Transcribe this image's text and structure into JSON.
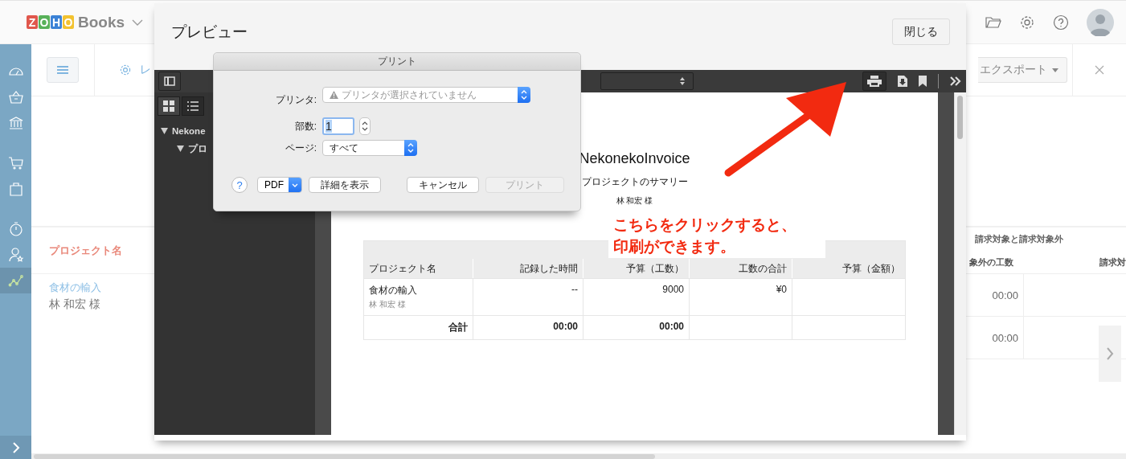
{
  "topbar": {
    "logo_letters": [
      {
        "letter": "Z",
        "color": "#e0574c"
      },
      {
        "letter": "O",
        "color": "#58b15a"
      },
      {
        "letter": "H",
        "color": "#3b82d6"
      },
      {
        "letter": "O",
        "color": "#f2c230"
      }
    ],
    "product": "Books"
  },
  "sidebar": {
    "groups": [
      {
        "items": [
          {
            "kind": "dashboard",
            "selected": false
          },
          {
            "kind": "basket",
            "selected": false
          },
          {
            "kind": "bank",
            "selected": false
          }
        ]
      },
      {
        "items": [
          {
            "kind": "cart",
            "selected": false
          },
          {
            "kind": "bag",
            "selected": false
          }
        ]
      },
      {
        "items": [
          {
            "kind": "timer",
            "selected": false
          },
          {
            "kind": "user",
            "selected": false
          },
          {
            "kind": "chart",
            "selected": true
          }
        ]
      }
    ]
  },
  "toolbar": {
    "settings_label": "レ",
    "export_label": "エクスポート"
  },
  "report": {
    "name_header": "プロジェクト名",
    "group_header": "請求対象と請求対象外",
    "columns": [
      "象外の工数",
      "請求対"
    ],
    "rows": [
      {
        "project": "食材の輸入",
        "client": "林 和宏 様",
        "time": "00:00"
      },
      {
        "time": "00:00"
      }
    ]
  },
  "preview": {
    "title": "プレビュー",
    "close": "閉じる",
    "tree": [
      {
        "label": "Nekone",
        "expanded": true,
        "children": [
          {
            "label": "プロ",
            "expanded": true
          }
        ]
      }
    ],
    "document": {
      "title": "NekonekoInvoice",
      "subtitle": "プロジェクトのサマリー",
      "client": "林 和宏 様",
      "columns": [
        "プロジェクト名",
        "記録した時間",
        "予算（工数）",
        "工数の合計",
        "予算（金額）"
      ],
      "rows": [
        {
          "cells": [
            "食材の輸入",
            "--",
            "9000",
            "¥0"
          ],
          "client": "林 和宏 様"
        }
      ],
      "total": {
        "cells": [
          "合計",
          "00:00",
          "00:00"
        ]
      }
    }
  },
  "annotation": {
    "lines": [
      "こちらをクリックすると、",
      "印刷ができます。"
    ]
  },
  "print_dialog": {
    "title": "プリント",
    "printer_label": "プリンタ:",
    "printer_placeholder": "プリンタが選択されていません",
    "copies_label": "部数:",
    "copies": "1",
    "pages_label": "ページ:",
    "pages": "すべて",
    "help": "?",
    "pdf": "PDF",
    "details": "詳細を表示",
    "cancel": "キャンセル",
    "print": {
      "label": "プリント",
      "disabled": true
    }
  }
}
